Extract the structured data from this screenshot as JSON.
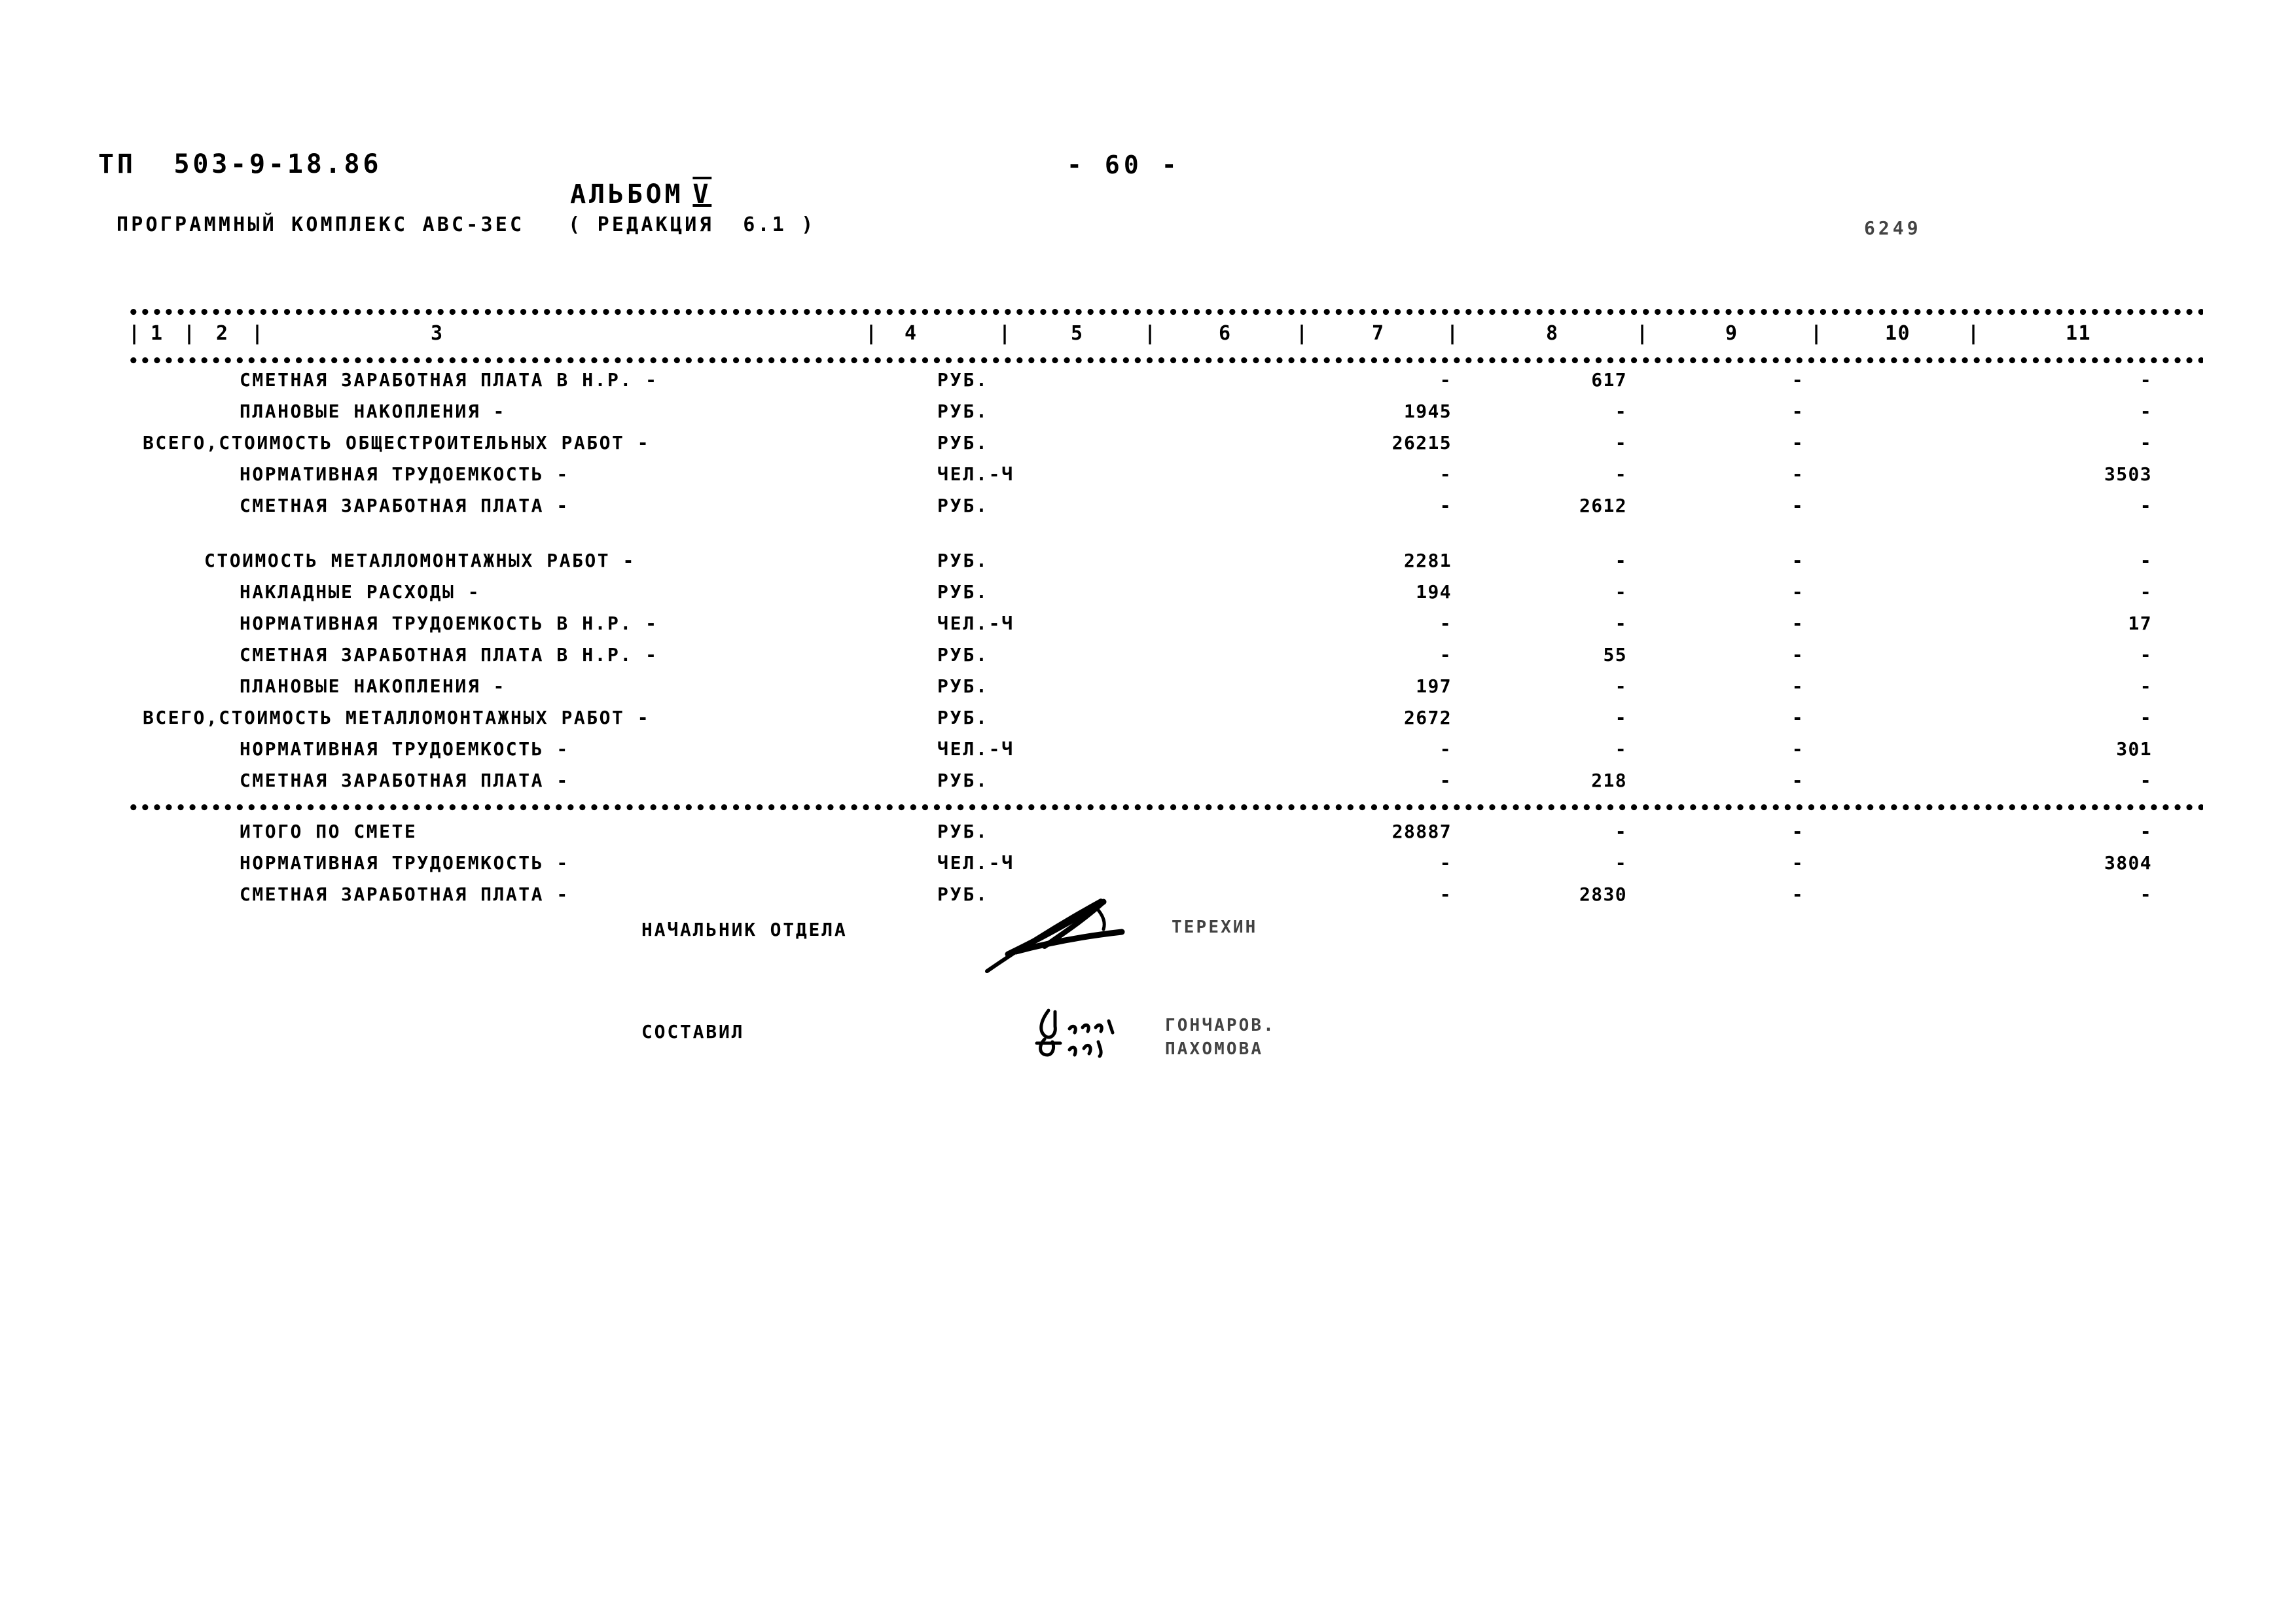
{
  "header": {
    "doc_code": "ТП  503-9-18.86",
    "album_label": "АЛЬБОМ",
    "album_number": "V",
    "page_number": "- 60 -",
    "program_line": "ПРОГРАММНЫЙ КОМПЛЕКС АВС-3ЕС   ( РЕДАКЦИЯ  6.1 )",
    "sheet_code": "6249"
  },
  "table": {
    "column_numbers": [
      "1",
      "2",
      "3",
      "4",
      "5",
      "6",
      "7",
      "8",
      "9",
      "10",
      "11"
    ],
    "dash": "-",
    "units": {
      "rub": "РУБ.",
      "man_hour": "ЧЕЛ.-Ч"
    },
    "block1": [
      {
        "label": "СМЕТНАЯ ЗАРАБОТНАЯ ПЛАТА В Н.Р. -",
        "unit": "РУБ.",
        "c7": "-",
        "c8": "617",
        "c9": "-",
        "c11": "-"
      },
      {
        "label": "ПЛАНОВЫЕ НАКОПЛЕНИЯ -",
        "unit": "РУБ.",
        "c7": "1945",
        "c8": "-",
        "c9": "-",
        "c11": "-"
      },
      {
        "label": "ВСЕГО,СТОИМОСТЬ ОБЩЕСТРОИТЕЛЬНЫХ РАБОТ -",
        "unit": "РУБ.",
        "c7": "26215",
        "c8": "-",
        "c9": "-",
        "c11": "-"
      },
      {
        "label": "НОРМАТИВНАЯ ТРУДОЕМКОСТЬ -",
        "unit": "ЧЕЛ.-Ч",
        "c7": "-",
        "c8": "-",
        "c9": "-",
        "c11": "3503"
      },
      {
        "label": "СМЕТНАЯ ЗАРАБОТНАЯ ПЛАТА -",
        "unit": "РУБ.",
        "c7": "-",
        "c8": "2612",
        "c9": "-",
        "c11": "-"
      }
    ],
    "block2": [
      {
        "label": "СТОИМОСТЬ МЕТАЛЛОМОНТАЖНЫХ РАБОТ -",
        "unit": "РУБ.",
        "c7": "2281",
        "c8": "-",
        "c9": "-",
        "c11": "-"
      },
      {
        "label": "НАКЛАДНЫЕ РАСХОДЫ -",
        "unit": "РУБ.",
        "c7": "194",
        "c8": "-",
        "c9": "-",
        "c11": "-"
      },
      {
        "label": "НОРМАТИВНАЯ ТРУДОЕМКОСТЬ В Н.Р. -",
        "unit": "ЧЕЛ.-Ч",
        "c7": "-",
        "c8": "-",
        "c9": "-",
        "c11": "17"
      },
      {
        "label": "СМЕТНАЯ ЗАРАБОТНАЯ ПЛАТА В Н.Р. -",
        "unit": "РУБ.",
        "c7": "-",
        "c8": "55",
        "c9": "-",
        "c11": "-"
      },
      {
        "label": "ПЛАНОВЫЕ НАКОПЛЕНИЯ -",
        "unit": "РУБ.",
        "c7": "197",
        "c8": "-",
        "c9": "-",
        "c11": "-"
      },
      {
        "label": "ВСЕГО,СТОИМОСТЬ МЕТАЛЛОМОНТАЖНЫХ РАБОТ -",
        "unit": "РУБ.",
        "c7": "2672",
        "c8": "-",
        "c9": "-",
        "c11": "-"
      },
      {
        "label": "НОРМАТИВНАЯ ТРУДОЕМКОСТЬ -",
        "unit": "ЧЕЛ.-Ч",
        "c7": "-",
        "c8": "-",
        "c9": "-",
        "c11": "301"
      },
      {
        "label": "СМЕТНАЯ ЗАРАБОТНАЯ ПЛАТА -",
        "unit": "РУБ.",
        "c7": "-",
        "c8": "218",
        "c9": "-",
        "c11": "-"
      }
    ],
    "totals": [
      {
        "label": "ИТОГО ПО СМЕТЕ",
        "unit": "РУБ.",
        "c7": "28887",
        "c8": "-",
        "c9": "-",
        "c11": "-"
      },
      {
        "label": "НОРМАТИВНАЯ ТРУДОЕМКОСТЬ -",
        "unit": "ЧЕЛ.-Ч",
        "c7": "-",
        "c8": "-",
        "c9": "-",
        "c11": "3804"
      },
      {
        "label": "СМЕТНАЯ ЗАРАБОТНАЯ ПЛАТА -",
        "unit": "РУБ.",
        "c7": "-",
        "c8": "2830",
        "c9": "-",
        "c11": "-"
      }
    ]
  },
  "signatures": {
    "head_title": "НАЧАЛЬНИК ОТДЕЛА",
    "head_name": "ТЕРЕХИН",
    "author_title": "СОСТАВИЛ",
    "author_name_1": "ГОНЧАРОВ.",
    "author_name_2": "ПАХОМОВА"
  }
}
